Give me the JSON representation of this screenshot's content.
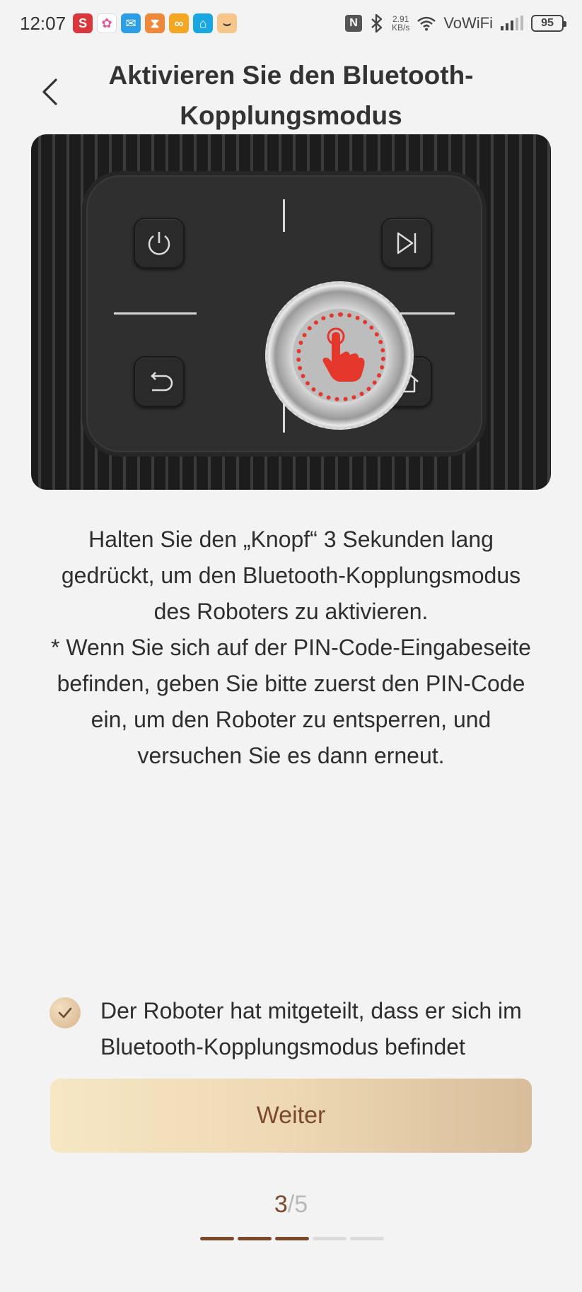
{
  "status_bar": {
    "time": "12:07",
    "notification_icons": [
      {
        "name": "s-app-icon",
        "glyph": "S",
        "color": "#d9363e"
      },
      {
        "name": "pinwheel-app-icon",
        "glyph": "✿",
        "color": "#ffffff"
      },
      {
        "name": "mail-app-icon",
        "glyph": "✉",
        "color": "#2b9ee6"
      },
      {
        "name": "hourglass-app-icon",
        "glyph": "⧗",
        "color": "#f0883a"
      },
      {
        "name": "link-app-icon",
        "glyph": "∞",
        "color": "#f5a623"
      },
      {
        "name": "house-app-icon",
        "glyph": "⌂",
        "color": "#1aa6e0"
      },
      {
        "name": "amazon-app-icon",
        "glyph": "⌣",
        "color": "#f0a04b"
      }
    ],
    "nfc_label": "N",
    "bluetooth_icon": "bluetooth-icon",
    "net_speed_value": "2.91",
    "net_speed_unit": "KB/s",
    "vowifi_label": "VoWiFi",
    "battery_level": "95"
  },
  "header": {
    "back_icon": "chevron-left-icon",
    "title": "Aktivieren Sie den Bluetooth-Kopplungsmodus"
  },
  "illustration": {
    "keys": [
      "power-icon",
      "skip-forward-icon",
      "return-icon",
      "home-icon"
    ],
    "center_icon": "tap-hand-icon",
    "accent_color": "#e5362c"
  },
  "description": {
    "instruction": "Halten Sie den „Knopf“ 3 Sekunden lang gedrückt, um den Bluetooth-Kopplungsmodus des Roboters zu aktivieren.",
    "note": "* Wenn Sie sich auf der PIN-Code-Eingabeseite befinden, geben Sie bitte zuerst den PIN-Code ein, um den Roboter zu entsperren, und versuchen Sie es dann erneut."
  },
  "confirmation": {
    "checked": true,
    "text": "Der Roboter hat mitgeteilt, dass er sich im Bluetooth-Kopplungsmodus befindet"
  },
  "next_button": {
    "label": "Weiter"
  },
  "pager": {
    "current": "3",
    "separator": "/",
    "total": "5",
    "active_color": "#7a4a2d"
  }
}
